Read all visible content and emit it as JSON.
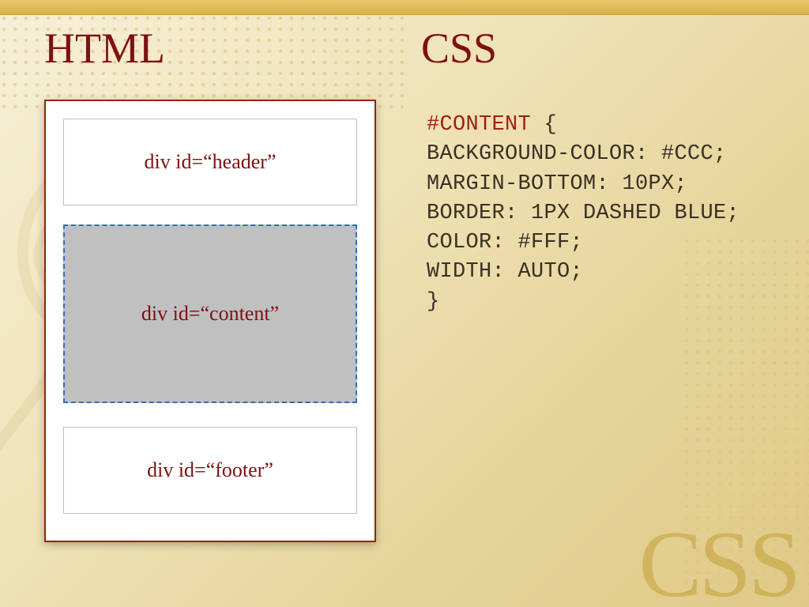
{
  "headings": {
    "left": "HTML",
    "right": "CSS"
  },
  "diagram": {
    "header_label": "div id=“header”",
    "content_label": "div id=“content”",
    "footer_label": "div id=“footer”"
  },
  "css_code": {
    "selector": "#content",
    "open_brace": " {",
    "lines": [
      "background-color: #ccc;",
      "margin-bottom: 10px;",
      "border: 1px dashed blue;",
      "color: #fff;",
      "width: auto;",
      "}"
    ]
  },
  "watermark": "CSS"
}
